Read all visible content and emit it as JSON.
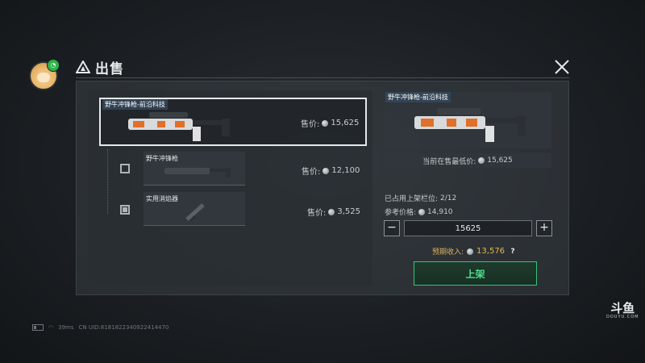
{
  "header": {
    "title": "出售"
  },
  "items": {
    "main": {
      "name": "野牛冲锋枪-前沿科技",
      "price_label": "售价:",
      "price": "15,625"
    },
    "sub": [
      {
        "name": "野牛冲锋枪",
        "price_label": "售价:",
        "price": "12,100"
      },
      {
        "name": "实用消焰器",
        "price_label": "售价:",
        "price": "3,525"
      }
    ]
  },
  "detail": {
    "name": "野牛冲锋枪-前沿科技",
    "low_price_label": "当前在售最低价:",
    "low_price": "15,625",
    "slots_label": "已占用上架栏位:",
    "slots_value": "2/12",
    "ref_price_label": "参考价格:",
    "ref_price": "14,910",
    "quantity_value": "15625",
    "minus_label": "−",
    "plus_label": "+",
    "income_label": "预期收入:",
    "income_value": "13,576",
    "help_label": "?",
    "list_button": "上架"
  },
  "status_bar": {
    "ping": "39ms",
    "uid": "CN UID:8181822340922414470"
  },
  "watermark": {
    "cn": "斗鱼",
    "en": "DOUYU.COM"
  },
  "colors": {
    "accent_green": "#39c27a",
    "income_gold": "#e0b84f"
  }
}
